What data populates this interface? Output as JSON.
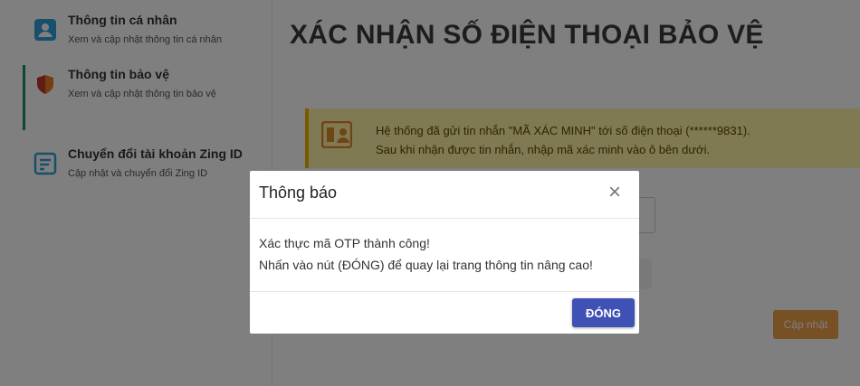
{
  "sidebar": {
    "items": [
      {
        "title": "Thông tin cá nhân",
        "subtitle": "Xem và cập nhật thông tin cá nhân",
        "icon": "user-card-icon",
        "active": false
      },
      {
        "title": "Thông tin bảo vệ",
        "subtitle": "Xem và cập nhật thông tin bảo vệ",
        "icon": "shield-icon",
        "active": true
      },
      {
        "title": "Chuyển đổi tài khoản Zing ID",
        "subtitle": "Cập nhật và chuyển đổi Zing ID",
        "icon": "document-icon",
        "active": false
      }
    ]
  },
  "main": {
    "title": "XÁC NHẬN SỐ ĐIỆN THOẠI BẢO VỆ",
    "notice": {
      "line1": "Hệ thống đã gửi tin nhắn \"MÃ XÁC MINH\" tới số điện thoại (******9831).",
      "line2": "Sau khi nhận được tin nhắn, nhập mã xác minh vào ô bên dưới.",
      "icon": "id-card-icon"
    },
    "update_button": "Cập nhật"
  },
  "modal": {
    "title": "Thông báo",
    "close_icon": "close-icon",
    "body_line1": "Xác thực mã OTP thành công!",
    "body_line2": "Nhấn vào nút (ĐÓNG) để quay lại trang thông tin nâng cao!",
    "button_label": "ĐÓNG"
  },
  "colors": {
    "accent_active": "#1a8f6a",
    "notice_bg": "#fff3a8",
    "notice_border": "#f0b400",
    "primary_button": "#3f51b5",
    "update_button": "#f0a04b"
  }
}
